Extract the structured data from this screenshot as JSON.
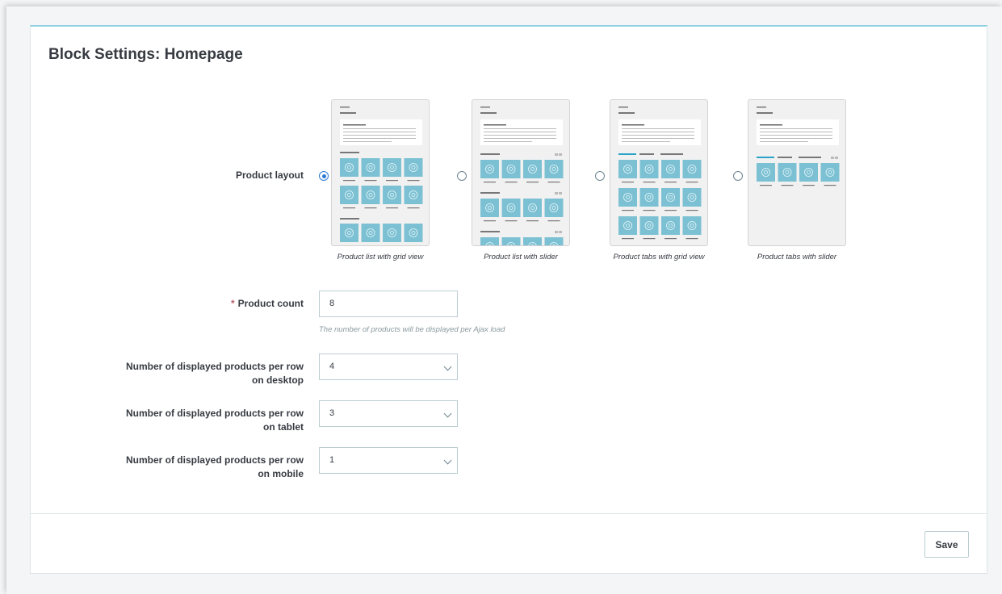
{
  "panel": {
    "title": "Block Settings: Homepage"
  },
  "form": {
    "product_layout_label": "Product layout",
    "layouts": [
      {
        "caption": "Product list with grid view",
        "selected": true
      },
      {
        "caption": "Product list with slider",
        "selected": false
      },
      {
        "caption": "Product tabs with grid view",
        "selected": false
      },
      {
        "caption": "Product tabs with slider",
        "selected": false
      }
    ],
    "product_count": {
      "required_mark": "*",
      "label": "Product count",
      "value": "8",
      "help": "The number of products will be displayed per Ajax load"
    },
    "desktop": {
      "label_line1": "Number of displayed products per row",
      "label_line2": "on desktop",
      "value": "4"
    },
    "tablet": {
      "label_line1": "Number of displayed products per row",
      "label_line2": "on tablet",
      "value": "3"
    },
    "mobile": {
      "label_line1": "Number of displayed products per row",
      "label_line2": "on mobile",
      "value": "1"
    }
  },
  "footer": {
    "save_label": "Save"
  },
  "colors": {
    "accent": "#2a7ad3",
    "thumb_tile": "#7cc1d3",
    "top_border": "#8fd0e2"
  },
  "icons": {
    "select_arrow": "chevron-down-icon",
    "product_image": "flower-icon"
  }
}
